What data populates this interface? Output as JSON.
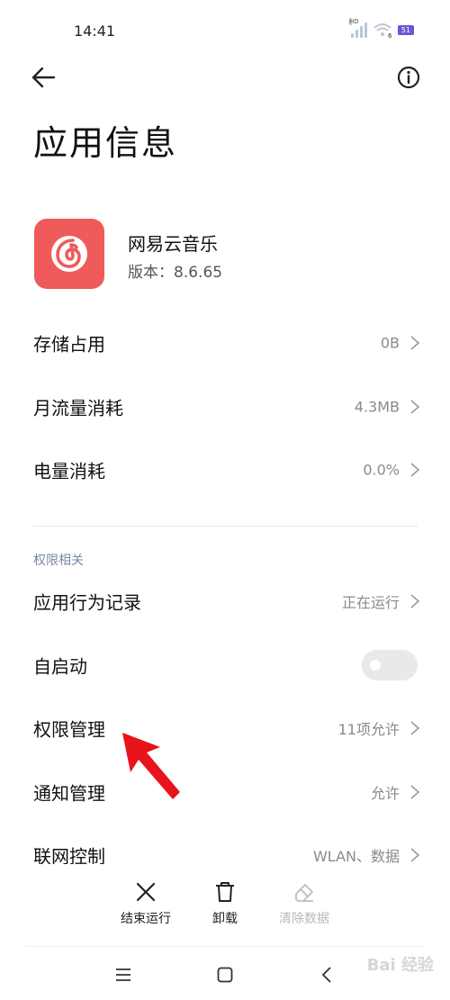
{
  "status_bar": {
    "time": "14:41",
    "hd_label": "HD",
    "wifi_label": "6",
    "battery_label": "51"
  },
  "header": {
    "title": "应用信息"
  },
  "app": {
    "name": "网易云音乐",
    "version": "版本：8.6.65"
  },
  "usage_rows": [
    {
      "label": "存储占用",
      "value": "0B"
    },
    {
      "label": "月流量消耗",
      "value": "4.3MB"
    },
    {
      "label": "电量消耗",
      "value": "0.0%"
    }
  ],
  "permissions": {
    "section_label": "权限相关",
    "rows": [
      {
        "label": "应用行为记录",
        "value": "正在运行"
      },
      {
        "label": "自启动",
        "value": ""
      },
      {
        "label": "权限管理",
        "value": "11项允许"
      },
      {
        "label": "通知管理",
        "value": "允许"
      },
      {
        "label": "联网控制",
        "value": "WLAN、数据"
      }
    ],
    "autostart_enabled": false
  },
  "actions": {
    "force_stop": "结束运行",
    "uninstall": "卸载",
    "clear_data": "清除数据"
  },
  "watermark": "Bai 经验",
  "colors": {
    "app_icon": "#ef5a5a",
    "section_label": "#7a86a8",
    "annotation_arrow": "#e8131b"
  }
}
